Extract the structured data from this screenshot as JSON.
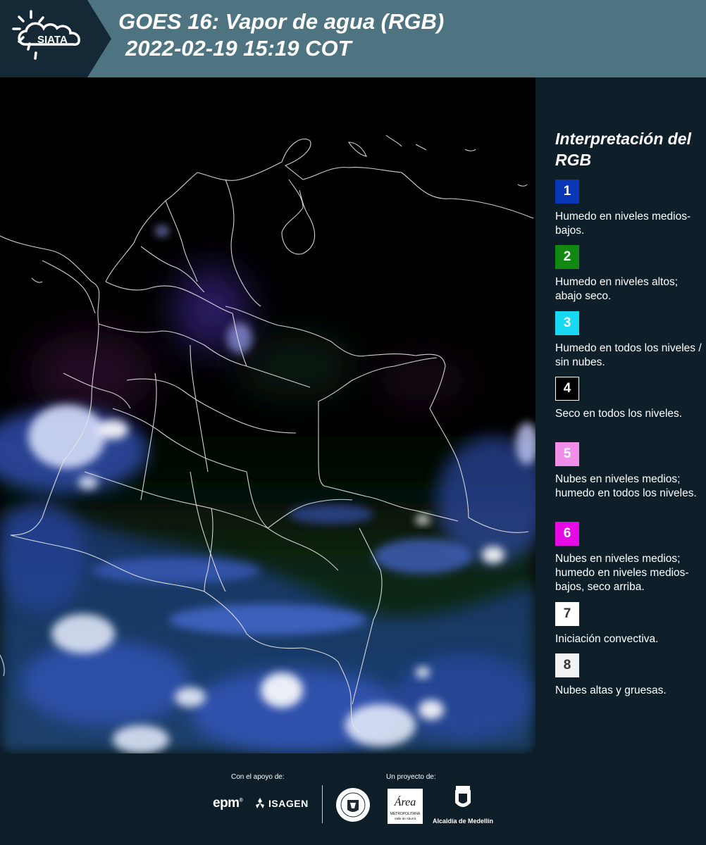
{
  "header": {
    "logo_text": "SIATA",
    "title_line1": "GOES 16: Vapor de agua (RGB)",
    "title_line2": "2022-02-19 15:19 COT"
  },
  "legend": {
    "title": "Interpretación del RGB",
    "items": [
      {
        "number": "1",
        "color": "#0a36b8",
        "number_color": "#ffffff",
        "description": "Humedo en niveles medios-bajos."
      },
      {
        "number": "2",
        "color": "#11880f",
        "number_color": "#ffffff",
        "description": "Humedo en niveles altos; abajo seco."
      },
      {
        "number": "3",
        "color": "#18d9f2",
        "number_color": "#ffffff",
        "description": "Humedo en todos los niveles / sin nubes."
      },
      {
        "number": "4",
        "color": "#000000",
        "number_color": "#ffffff",
        "description": "Seco en todos los niveles."
      },
      {
        "number": "5",
        "color": "#f08ee8",
        "number_color": "#ffffff",
        "description": "Nubes en niveles medios; humedo en todos los niveles."
      },
      {
        "number": "6",
        "color": "#e60ae6",
        "number_color": "#ffffff",
        "description": "Nubes en niveles medios; humedo en niveles medios-bajos, seco arriba."
      },
      {
        "number": "7",
        "color": "#ffffff",
        "number_color": "#333333",
        "description": "Iniciación convectiva."
      },
      {
        "number": "8",
        "color": "#f2f2f2",
        "number_color": "#333333",
        "description": "Nubes altas y gruesas."
      }
    ]
  },
  "footer": {
    "support_label": "Con el apoyo de:",
    "project_label": "Un proyecto de:",
    "epm_text": "epm",
    "isagen_text": "ISAGEN",
    "metro_text": "Área",
    "metro_subtext": "METROPOLITANA",
    "metro_subtext2": "Valle de Aburrá",
    "alcaldia_text": "Alcaldía de Medellín"
  }
}
